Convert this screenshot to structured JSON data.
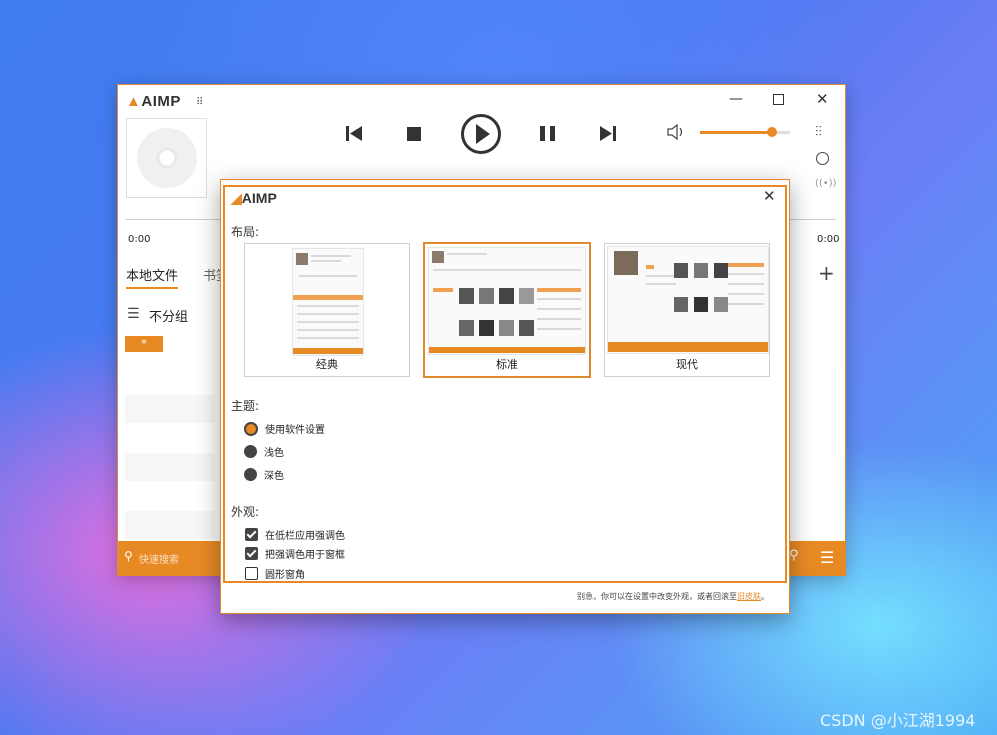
{
  "player": {
    "logo": "AIMP",
    "time_start": "0:00",
    "time_end": "0:00",
    "tabs": [
      "本地文件",
      "书签"
    ],
    "group_label": "不分组",
    "group_badge": "*",
    "search_placeholder": "快速搜索",
    "volume_percent": 80
  },
  "dialog": {
    "logo": "AIMP",
    "layout_label": "布局:",
    "layouts": [
      {
        "label": "经典",
        "selected": false
      },
      {
        "label": "标准",
        "selected": true
      },
      {
        "label": "现代",
        "selected": false
      }
    ],
    "theme_label": "主题:",
    "themes": [
      {
        "label": "使用软件设置",
        "selected": true
      },
      {
        "label": "浅色",
        "selected": false
      },
      {
        "label": "深色",
        "selected": false
      }
    ],
    "appearance_label": "外观:",
    "appearance": [
      {
        "label": "在低栏应用强调色",
        "checked": true
      },
      {
        "label": "把强调色用于窗框",
        "checked": true
      },
      {
        "label": "圆形窗角",
        "checked": false
      }
    ],
    "footer_text": "别急，你可以在设置中改变外观，或者回滚至",
    "footer_link": "旧皮肤",
    "footer_end": "。"
  },
  "watermark": "CSDN @小江湖1994",
  "colors": {
    "accent": "#e88a24",
    "frame": "#e08a2e"
  }
}
